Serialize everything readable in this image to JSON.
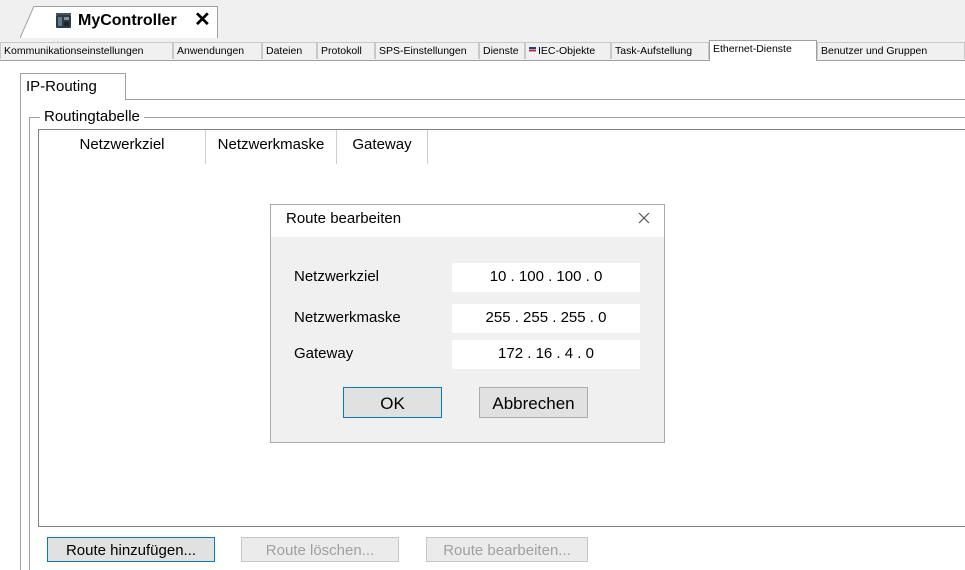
{
  "document_tab": {
    "title": "MyController",
    "close_glyph": "✕",
    "icon": "controller-icon"
  },
  "settings_tabs": [
    {
      "label": "Kommunikationseinstellungen"
    },
    {
      "label": "Anwendungen"
    },
    {
      "label": "Dateien"
    },
    {
      "label": "Protokoll"
    },
    {
      "label": "SPS-Einstellungen"
    },
    {
      "label": "Dienste"
    },
    {
      "label": "IEC-Objekte"
    },
    {
      "label": "Task-Aufstellung"
    },
    {
      "label": "Ethernet-Dienste"
    },
    {
      "label": "Benutzer und Gruppen"
    }
  ],
  "sub_tab": {
    "label": "IP-Routing"
  },
  "routing": {
    "group_title": "Routingtabelle",
    "columns": [
      "Netzwerkziel",
      "Netzwerkmaske",
      "Gateway"
    ]
  },
  "buttons": {
    "add": "Route hinzufügen...",
    "delete": "Route löschen...",
    "edit": "Route bearbeiten..."
  },
  "dialog": {
    "title": "Route bearbeiten",
    "fields": [
      {
        "label": "Netzwerkziel",
        "value": "10 . 100 . 100 . 0"
      },
      {
        "label": "Netzwerkmaske",
        "value": "255 . 255 . 255 . 0"
      },
      {
        "label": "Gateway",
        "value": "172 . 16 . 4 . 0"
      }
    ],
    "ok": "OK",
    "cancel": "Abbrechen"
  },
  "colors": {
    "focus_border": "#0078d7",
    "window_bg": "#f0f0f0",
    "panel_bg": "#ffffff"
  }
}
